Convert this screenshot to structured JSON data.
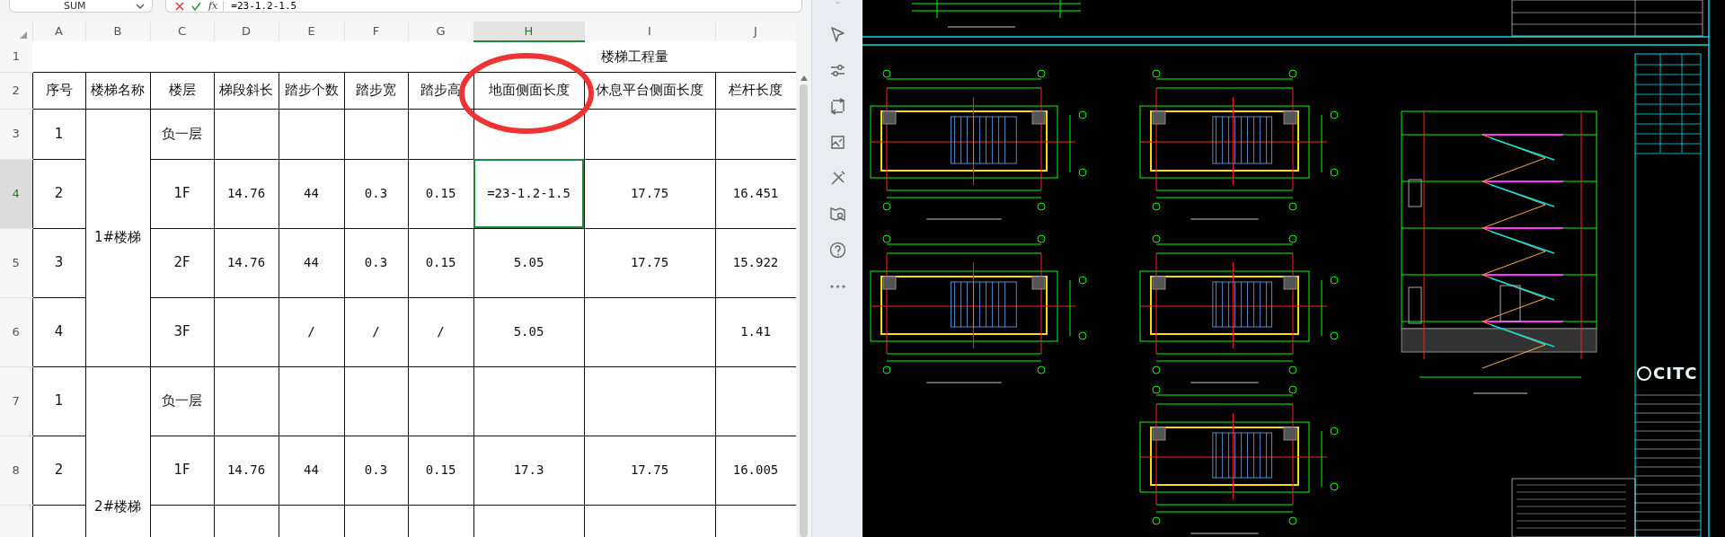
{
  "formula_bar": {
    "name_box": "SUM",
    "fx_label": "fx",
    "formula": "=23-1.2-1.5"
  },
  "columns": [
    {
      "letter": "A",
      "selected": false
    },
    {
      "letter": "B",
      "selected": false
    },
    {
      "letter": "C",
      "selected": false
    },
    {
      "letter": "D",
      "selected": false
    },
    {
      "letter": "E",
      "selected": false
    },
    {
      "letter": "F",
      "selected": false
    },
    {
      "letter": "G",
      "selected": false
    },
    {
      "letter": "H",
      "selected": true
    },
    {
      "letter": "I",
      "selected": false
    },
    {
      "letter": "J",
      "selected": false
    }
  ],
  "title_row": {
    "row_number": "1",
    "title": "楼梯工程量"
  },
  "header_row": {
    "row_number": "2",
    "headers": [
      "序号",
      "楼梯名称",
      "楼层",
      "梯段斜长",
      "踏步个数",
      "踏步宽",
      "踏步高",
      "地面侧面长度",
      "休息平台侧面长度",
      "栏杆长度"
    ]
  },
  "groups": [
    {
      "name": "1#楼梯",
      "rows": [
        {
          "row_number": "3",
          "selected": false,
          "cells": {
            "A": "1",
            "C": "负一层"
          }
        },
        {
          "row_number": "4",
          "selected": true,
          "cells": {
            "A": "2",
            "C": "1F",
            "D": "14.76",
            "E": "44",
            "F": "0.3",
            "G": "0.15",
            "H": "=23-1.2-1.5",
            "I": "17.75",
            "J": "16.451"
          }
        },
        {
          "row_number": "5",
          "selected": false,
          "cells": {
            "A": "3",
            "C": "2F",
            "D": "14.76",
            "E": "44",
            "F": "0.3",
            "G": "0.15",
            "H": "5.05",
            "I": "17.75",
            "J": "15.922"
          }
        },
        {
          "row_number": "6",
          "selected": false,
          "cells": {
            "A": "4",
            "C": "3F",
            "E": "/",
            "F": "/",
            "G": "/",
            "H": "5.05",
            "J": "1.41"
          }
        }
      ]
    },
    {
      "name": "2#楼梯",
      "rows": [
        {
          "row_number": "7",
          "selected": false,
          "cells": {
            "A": "1",
            "C": "负一层"
          }
        },
        {
          "row_number": "8",
          "selected": false,
          "cells": {
            "A": "2",
            "C": "1F",
            "D": "14.76",
            "E": "44",
            "F": "0.3",
            "G": "0.15",
            "H": "17.3",
            "I": "17.75",
            "J": "16.005"
          }
        }
      ]
    }
  ],
  "cad": {
    "logo": "CITC"
  }
}
